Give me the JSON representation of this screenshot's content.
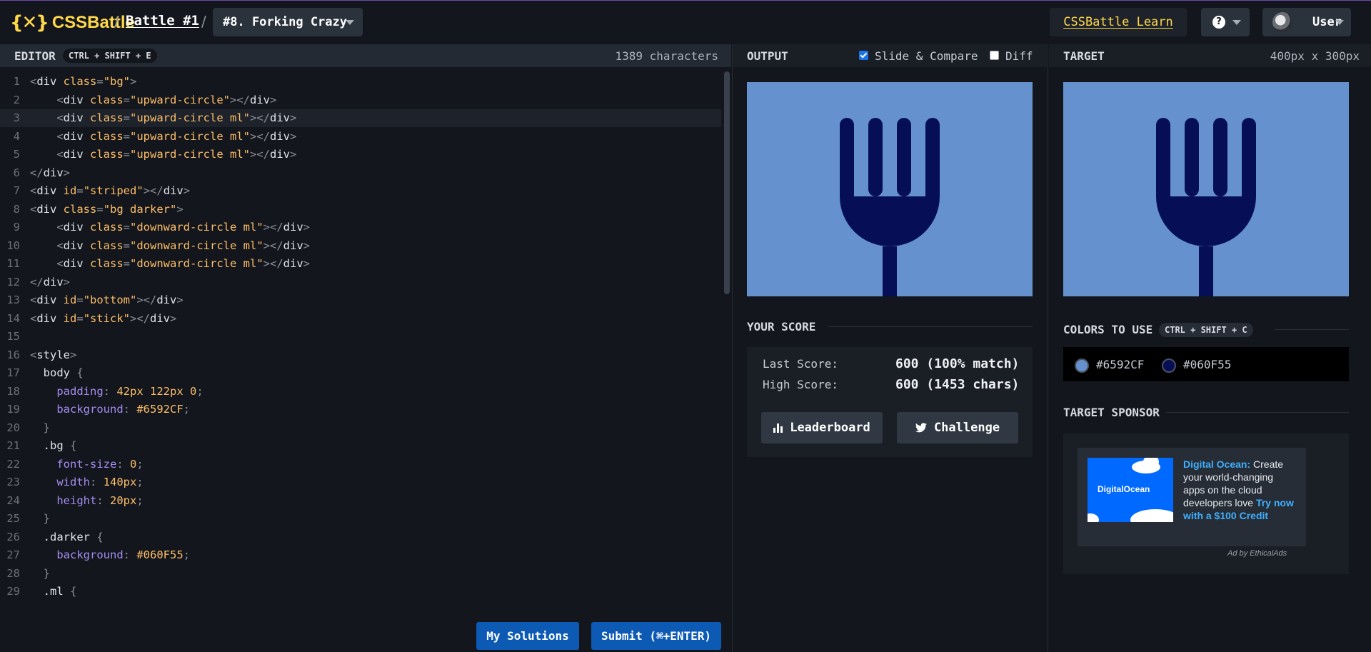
{
  "header": {
    "logo_glyph": "{✕}",
    "logo_text": "CSSBattle",
    "separator": "/",
    "battle_label": "Battle #1",
    "target_select_value": "#8. Forking Crazy",
    "learn_label": "CSSBattle Learn",
    "help_glyph": "?",
    "user_label": "User"
  },
  "editor": {
    "label": "EDITOR",
    "shortcut": "CTRL + SHIFT + E",
    "char_count": "1389 characters",
    "active_line": 3,
    "lines": [
      [
        [
          "t-pun",
          "<"
        ],
        [
          "t-tag",
          "div "
        ],
        [
          "t-attr",
          "class"
        ],
        [
          "t-pun",
          "="
        ],
        [
          "t-str",
          "\"bg\""
        ],
        [
          "t-pun",
          ">"
        ]
      ],
      [
        [
          "t-pun",
          "    <"
        ],
        [
          "t-tag",
          "div "
        ],
        [
          "t-attr",
          "class"
        ],
        [
          "t-pun",
          "="
        ],
        [
          "t-str",
          "\"upward-circle\""
        ],
        [
          "t-pun",
          "></"
        ],
        [
          "t-tag",
          "div"
        ],
        [
          "t-pun",
          ">"
        ]
      ],
      [
        [
          "t-pun",
          "    <"
        ],
        [
          "t-tag",
          "div "
        ],
        [
          "t-attr",
          "class"
        ],
        [
          "t-pun",
          "="
        ],
        [
          "t-str",
          "\"upward-circle ml\""
        ],
        [
          "t-pun",
          "></"
        ],
        [
          "t-tag",
          "div"
        ],
        [
          "t-pun",
          ">"
        ]
      ],
      [
        [
          "t-pun",
          "    <"
        ],
        [
          "t-tag",
          "div "
        ],
        [
          "t-attr",
          "class"
        ],
        [
          "t-pun",
          "="
        ],
        [
          "t-str",
          "\"upward-circle ml\""
        ],
        [
          "t-pun",
          "></"
        ],
        [
          "t-tag",
          "div"
        ],
        [
          "t-pun",
          ">"
        ]
      ],
      [
        [
          "t-pun",
          "    <"
        ],
        [
          "t-tag",
          "div "
        ],
        [
          "t-attr",
          "class"
        ],
        [
          "t-pun",
          "="
        ],
        [
          "t-str",
          "\"upward-circle ml\""
        ],
        [
          "t-pun",
          "></"
        ],
        [
          "t-tag",
          "div"
        ],
        [
          "t-pun",
          ">"
        ]
      ],
      [
        [
          "t-pun",
          "</"
        ],
        [
          "t-tag",
          "div"
        ],
        [
          "t-pun",
          ">"
        ]
      ],
      [
        [
          "t-pun",
          "<"
        ],
        [
          "t-tag",
          "div "
        ],
        [
          "t-attr",
          "id"
        ],
        [
          "t-pun",
          "="
        ],
        [
          "t-str",
          "\"striped\""
        ],
        [
          "t-pun",
          "></"
        ],
        [
          "t-tag",
          "div"
        ],
        [
          "t-pun",
          ">"
        ]
      ],
      [
        [
          "t-pun",
          "<"
        ],
        [
          "t-tag",
          "div "
        ],
        [
          "t-attr",
          "class"
        ],
        [
          "t-pun",
          "="
        ],
        [
          "t-str",
          "\"bg darker\""
        ],
        [
          "t-pun",
          ">"
        ]
      ],
      [
        [
          "t-pun",
          "    <"
        ],
        [
          "t-tag",
          "div "
        ],
        [
          "t-attr",
          "class"
        ],
        [
          "t-pun",
          "="
        ],
        [
          "t-str",
          "\"downward-circle ml\""
        ],
        [
          "t-pun",
          "></"
        ],
        [
          "t-tag",
          "div"
        ],
        [
          "t-pun",
          ">"
        ]
      ],
      [
        [
          "t-pun",
          "    <"
        ],
        [
          "t-tag",
          "div "
        ],
        [
          "t-attr",
          "class"
        ],
        [
          "t-pun",
          "="
        ],
        [
          "t-str",
          "\"downward-circle ml\""
        ],
        [
          "t-pun",
          "></"
        ],
        [
          "t-tag",
          "div"
        ],
        [
          "t-pun",
          ">"
        ]
      ],
      [
        [
          "t-pun",
          "    <"
        ],
        [
          "t-tag",
          "div "
        ],
        [
          "t-attr",
          "class"
        ],
        [
          "t-pun",
          "="
        ],
        [
          "t-str",
          "\"downward-circle ml\""
        ],
        [
          "t-pun",
          "></"
        ],
        [
          "t-tag",
          "div"
        ],
        [
          "t-pun",
          ">"
        ]
      ],
      [
        [
          "t-pun",
          "</"
        ],
        [
          "t-tag",
          "div"
        ],
        [
          "t-pun",
          ">"
        ]
      ],
      [
        [
          "t-pun",
          "<"
        ],
        [
          "t-tag",
          "div "
        ],
        [
          "t-attr",
          "id"
        ],
        [
          "t-pun",
          "="
        ],
        [
          "t-str",
          "\"bottom\""
        ],
        [
          "t-pun",
          "></"
        ],
        [
          "t-tag",
          "div"
        ],
        [
          "t-pun",
          ">"
        ]
      ],
      [
        [
          "t-pun",
          "<"
        ],
        [
          "t-tag",
          "div "
        ],
        [
          "t-attr",
          "id"
        ],
        [
          "t-pun",
          "="
        ],
        [
          "t-str",
          "\"stick\""
        ],
        [
          "t-pun",
          "></"
        ],
        [
          "t-tag",
          "div"
        ],
        [
          "t-pun",
          ">"
        ]
      ],
      [],
      [
        [
          "t-pun",
          "<"
        ],
        [
          "t-tag",
          "style"
        ],
        [
          "t-pun",
          ">"
        ]
      ],
      [
        [
          "t-tag",
          "  body "
        ],
        [
          "t-pun",
          "{"
        ]
      ],
      [
        [
          "t-prop",
          "    padding"
        ],
        [
          "t-pun",
          ": "
        ],
        [
          "t-val",
          "42px 122px 0"
        ],
        [
          "t-pun",
          ";"
        ]
      ],
      [
        [
          "t-prop",
          "    background"
        ],
        [
          "t-pun",
          ": "
        ],
        [
          "t-val",
          "#6592CF"
        ],
        [
          "t-pun",
          ";"
        ]
      ],
      [
        [
          "t-pun",
          "  }"
        ]
      ],
      [
        [
          "t-tag",
          "  .bg "
        ],
        [
          "t-pun",
          "{"
        ]
      ],
      [
        [
          "t-prop",
          "    font-size"
        ],
        [
          "t-pun",
          ": "
        ],
        [
          "t-val",
          "0"
        ],
        [
          "t-pun",
          ";"
        ]
      ],
      [
        [
          "t-prop",
          "    width"
        ],
        [
          "t-pun",
          ": "
        ],
        [
          "t-val",
          "140px"
        ],
        [
          "t-pun",
          ";"
        ]
      ],
      [
        [
          "t-prop",
          "    height"
        ],
        [
          "t-pun",
          ": "
        ],
        [
          "t-val",
          "20px"
        ],
        [
          "t-pun",
          ";"
        ]
      ],
      [
        [
          "t-pun",
          "  }"
        ]
      ],
      [
        [
          "t-tag",
          "  .darker "
        ],
        [
          "t-pun",
          "{"
        ]
      ],
      [
        [
          "t-prop",
          "    background"
        ],
        [
          "t-pun",
          ": "
        ],
        [
          "t-val",
          "#060F55"
        ],
        [
          "t-pun",
          ";"
        ]
      ],
      [
        [
          "t-pun",
          "  }"
        ]
      ],
      [
        [
          "t-tag",
          "  .ml "
        ],
        [
          "t-pun",
          "{"
        ]
      ]
    ],
    "solutions_label": "My Solutions",
    "submit_label": "Submit (⌘+ENTER)"
  },
  "output": {
    "label": "OUTPUT",
    "slide_compare_label": "Slide & Compare",
    "slide_compare_checked": true,
    "diff_label": "Diff",
    "diff_checked": false
  },
  "target": {
    "label": "TARGET",
    "size": "400px x 300px"
  },
  "score": {
    "title": "YOUR SCORE",
    "last_label": "Last Score:",
    "last_value": "600 (100% match)",
    "high_label": "High Score:",
    "high_value": "600 (1453 chars)",
    "leaderboard_label": "Leaderboard",
    "challenge_label": "Challenge"
  },
  "colors": {
    "title": "COLORS TO USE",
    "shortcut": "CTRL + SHIFT + C",
    "items": [
      {
        "label": "#6592CF",
        "hex": "#6592CF"
      },
      {
        "label": "#060F55",
        "hex": "#060F55"
      }
    ]
  },
  "sponsor": {
    "title": "TARGET SPONSOR",
    "brand_label": "DigitalOcean",
    "name": "Digital Ocean:",
    "text": " Create your world-changing apps on the cloud developers love ",
    "cta": "Try now with a $100 Credit",
    "footer": "Ad by EthicalAds"
  }
}
